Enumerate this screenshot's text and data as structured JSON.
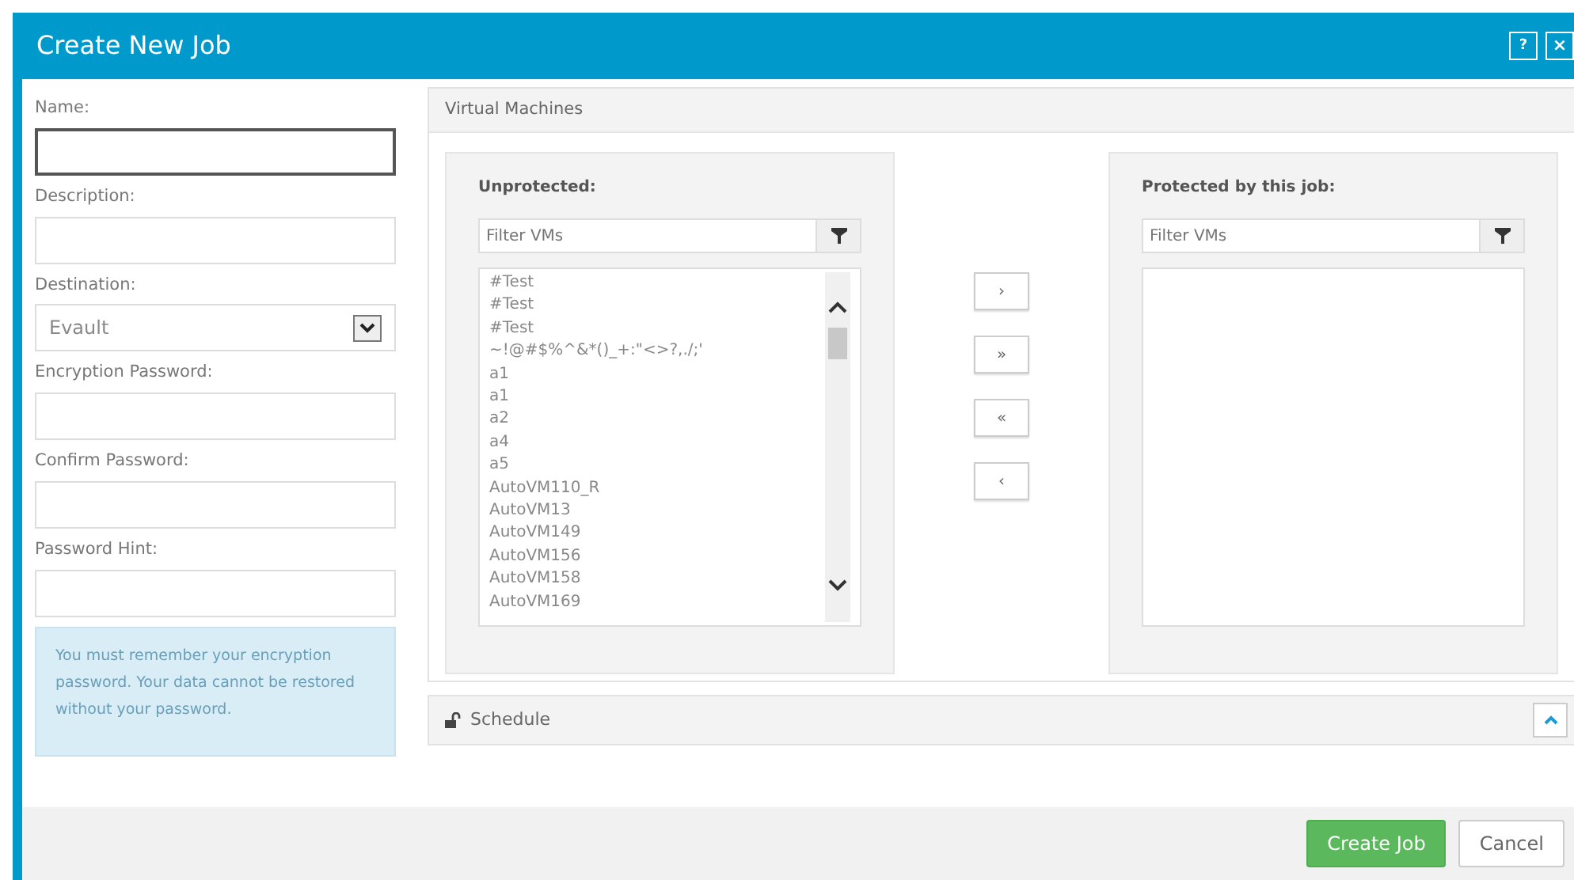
{
  "window": {
    "title": "Create New Job",
    "buttons": [
      {
        "kind": "help",
        "label": "?"
      },
      {
        "kind": "close",
        "label": "×"
      }
    ]
  },
  "form": {
    "fields": [
      {
        "label": "Name:",
        "kind": "text",
        "focused": true
      },
      {
        "label": "Description:",
        "kind": "text",
        "focused": false
      },
      {
        "label": "Destination:",
        "kind": "select",
        "value": "Evault",
        "focused": false
      },
      {
        "label": "Encryption Password:",
        "kind": "text",
        "focused": false
      },
      {
        "label": "Confirm Password:",
        "kind": "text",
        "focused": false
      },
      {
        "label": "Password Hint:",
        "kind": "text",
        "focused": false
      }
    ],
    "notice": "You must remember your encryption password. Your data cannot be restored without your password."
  },
  "virtual_machines": {
    "title": "Virtual Machines",
    "unprotected": {
      "title": "Unprotected:",
      "filter_placeholder": "Filter VMs",
      "items": [
        "#Test",
        "#Test",
        "#Test",
        "~!@#$%^&*()_+:\"<>?,./;'",
        "a1",
        "a1",
        "a2",
        "a4",
        "a5",
        "AutoVM110_R",
        "AutoVM13",
        "AutoVM149",
        "AutoVM156",
        "AutoVM158",
        "AutoVM169"
      ]
    },
    "transfer_buttons": [
      {
        "label": "›"
      },
      {
        "label": "»"
      },
      {
        "label": "«"
      },
      {
        "label": "‹"
      }
    ],
    "protected": {
      "title": "Protected by this job:",
      "filter_placeholder": "Filter VMs"
    }
  },
  "schedule": {
    "title": "Schedule",
    "expanded": false
  },
  "footer": {
    "buttons": [
      {
        "kind": "primary",
        "label": "Create Job"
      },
      {
        "kind": "secondary",
        "label": "Cancel"
      }
    ]
  }
}
